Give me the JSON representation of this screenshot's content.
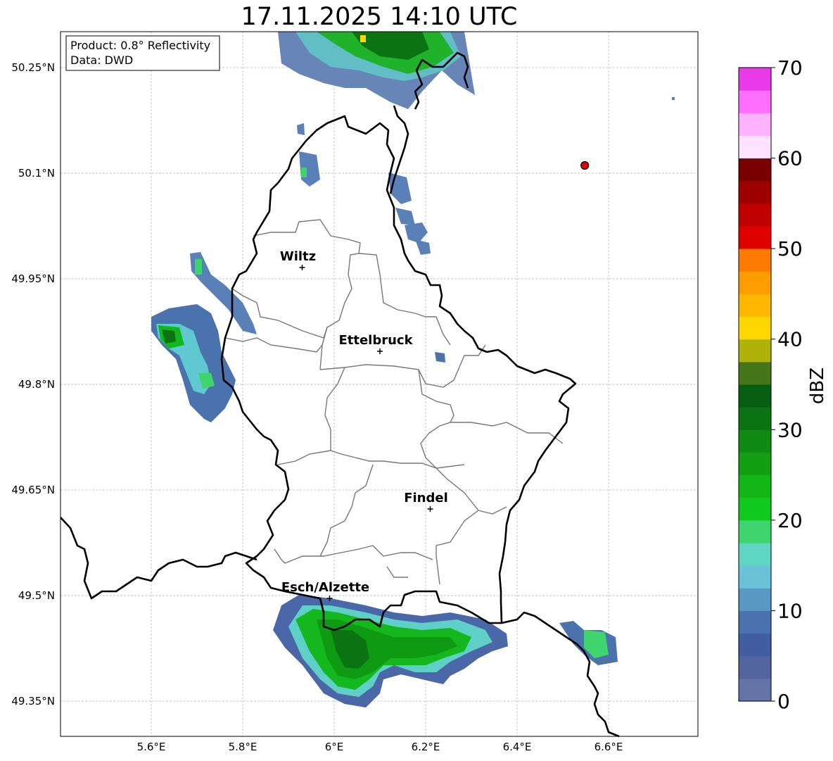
{
  "title": "17.11.2025 14:10 UTC",
  "info_box": {
    "product": "Product: 0.8° Reflectivity",
    "data": "Data: DWD"
  },
  "lat_ticks": [
    "50.25°N",
    "50.1°N",
    "49.95°N",
    "49.8°N",
    "49.65°N",
    "49.5°N",
    "49.35°N"
  ],
  "lon_ticks": [
    "5.6°E",
    "5.8°E",
    "6°E",
    "6.2°E",
    "6.4°E",
    "6.6°E"
  ],
  "cities": [
    {
      "name": "Wiltz",
      "lon": 5.93,
      "lat": 49.966
    },
    {
      "name": "Ettelbruck",
      "lon": 6.1,
      "lat": 49.847
    },
    {
      "name": "Findel",
      "lon": 6.21,
      "lat": 49.623
    },
    {
      "name": "Esch/Alzette",
      "lon": 5.99,
      "lat": 49.496
    }
  ],
  "radar_site": {
    "lon": 6.548,
    "lat": 50.111,
    "color": "#e00000"
  },
  "colorbar": {
    "label": "dBZ",
    "ticks": [
      "0",
      "10",
      "20",
      "30",
      "40",
      "50",
      "60",
      "70"
    ],
    "range": [
      0,
      70
    ],
    "colors": [
      "#6275a6",
      "#53659f",
      "#425ea2",
      "#4a73ad",
      "#5a98c4",
      "#6ac1d8",
      "#60d5c2",
      "#3ed46e",
      "#11c81d",
      "#12b715",
      "#12a012",
      "#0f8a12",
      "#0b7312",
      "#075e12",
      "#46761a",
      "#b0b20a",
      "#ffd700",
      "#ffb700",
      "#ff9c00",
      "#ff7a00",
      "#e00000",
      "#c00000",
      "#9e0000",
      "#7a0000",
      "#ffe2ff",
      "#ffb3ff",
      "#ff6eff",
      "#e83ae8"
    ]
  }
}
